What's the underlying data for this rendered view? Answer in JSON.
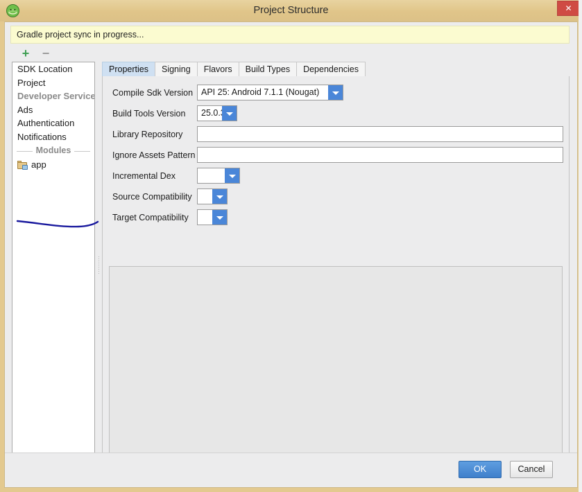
{
  "window": {
    "title": "Project Structure",
    "icon": "android-studio-icon",
    "close_label": "✕",
    "titlebar_color": "#e3c98f",
    "close_color": "#cf4b44"
  },
  "banner": {
    "text": "Gradle project sync in progress...",
    "background": "#fbfbd0"
  },
  "left_toolbar": {
    "add_label": "+",
    "remove_label": "−"
  },
  "sidebar": {
    "items": [
      {
        "label": "SDK Location",
        "type": "item"
      },
      {
        "label": "Project",
        "type": "item"
      },
      {
        "label": "Developer Services",
        "type": "header"
      },
      {
        "label": "Ads",
        "type": "item"
      },
      {
        "label": "Authentication",
        "type": "item"
      },
      {
        "label": "Notifications",
        "type": "item"
      }
    ],
    "separator_label": "Modules",
    "modules": [
      {
        "label": "app",
        "icon": "module-folder-icon"
      }
    ]
  },
  "tabs": [
    {
      "label": "Properties",
      "active": true
    },
    {
      "label": "Signing",
      "active": false
    },
    {
      "label": "Flavors",
      "active": false
    },
    {
      "label": "Build Types",
      "active": false
    },
    {
      "label": "Dependencies",
      "active": false
    }
  ],
  "properties": {
    "compile_sdk_version": {
      "label": "Compile Sdk Version",
      "value": "API 25: Android 7.1.1 (Nougat)"
    },
    "build_tools_version": {
      "label": "Build Tools Version",
      "value": "25.0.3"
    },
    "library_repository": {
      "label": "Library Repository",
      "value": "",
      "placeholder": ""
    },
    "ignore_assets_pattern": {
      "label": "Ignore Assets Pattern",
      "value": "",
      "placeholder": ""
    },
    "incremental_dex": {
      "label": "Incremental Dex",
      "value": ""
    },
    "source_compatibility": {
      "label": "Source Compatibility",
      "value": ""
    },
    "target_compatibility": {
      "label": "Target Compatibility",
      "value": ""
    }
  },
  "footer": {
    "ok_label": "OK",
    "cancel_label": "Cancel",
    "ok_color": "#3f7fcb"
  },
  "annotation": {
    "ink_color": "#1a1a9e"
  }
}
